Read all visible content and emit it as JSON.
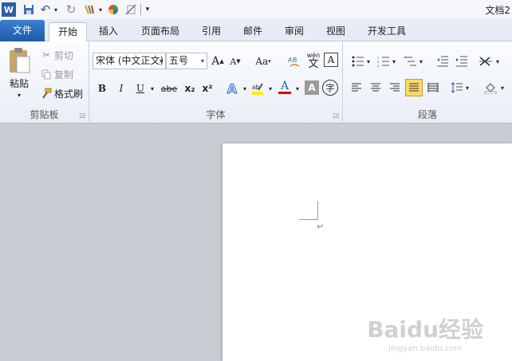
{
  "window": {
    "title": "文档2"
  },
  "qat": {
    "app_icon": "word-logo-icon",
    "app_label": "W",
    "items": [
      "save-icon",
      "undo-icon",
      "redo-icon",
      "format-painter-icon",
      "color-wheel-icon",
      "clear-icon",
      "customize-icon"
    ]
  },
  "tabs": [
    {
      "label": "文件"
    },
    {
      "label": "开始"
    },
    {
      "label": "插入"
    },
    {
      "label": "页面布局"
    },
    {
      "label": "引用"
    },
    {
      "label": "邮件"
    },
    {
      "label": "审阅"
    },
    {
      "label": "视图"
    },
    {
      "label": "开发工具"
    }
  ],
  "clipboard": {
    "label": "剪贴板",
    "paste": "粘贴",
    "cut": "剪切",
    "copy": "复制",
    "format_painter": "格式刷"
  },
  "font": {
    "label": "字体",
    "font_name": "宋体 (中文正文)",
    "font_size": "五号",
    "grow": "A",
    "shrink": "A",
    "change_case": "Aa",
    "bold": "B",
    "italic": "I",
    "underline": "U",
    "strikethrough": "abe",
    "subscript": "x₂",
    "superscript": "x²",
    "text_effect": "A",
    "font_color": "A",
    "char_shading": "A",
    "enclose": "字",
    "phonetic": "wén",
    "phonetic_char": "文",
    "char_border": "A",
    "colors": {
      "highlight": "#ffee00",
      "font_color": "#e00000",
      "accent": "#2b5fa6"
    }
  },
  "paragraph": {
    "label": "段落"
  },
  "document": {
    "para_mark": "↵"
  },
  "watermark": {
    "main": "Baidu经验",
    "sub": "jingyan.baidu.com"
  }
}
